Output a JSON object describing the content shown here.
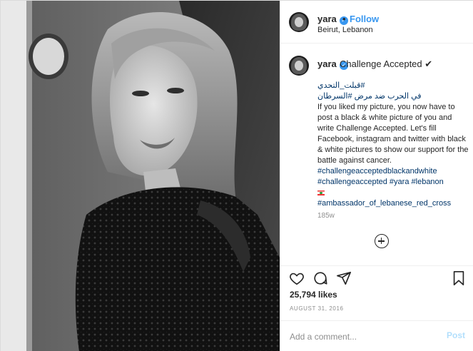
{
  "post": {
    "username": "yara",
    "follow_label": "Follow",
    "separator": "•",
    "location": "Beirut, Lebanon",
    "verified_icon": "verified-badge-icon",
    "caption_title": "Challenge Accepted ✔",
    "caption": {
      "hashtag_ar_1": "#قبلت_التحدي",
      "hashtag_ar_2": "في الحرب ضد مرض #السرطان",
      "body": "If you liked my picture, you now have to post a black & white picture of you and write Challenge Accepted. Let's fill Facebook, instagram and twitter with black & white pictures to show our support for the battle against cancer.",
      "hashtag_1": "#challengeacceptedblackandwhite",
      "hashtag_2": "#challengeaccepted",
      "hashtag_3": "#yara",
      "hashtag_4": "#lebanon",
      "flag": "lebanon-flag-icon",
      "hashtag_5": "#ambassador_of_lebanese_red_cross"
    },
    "age": "185w",
    "likes": "25,794 likes",
    "date": "AUGUST 31, 2016"
  },
  "comment_box": {
    "placeholder": "Add a comment...",
    "post_label": "Post"
  },
  "icons": {
    "like": "heart-icon",
    "comment": "comment-icon",
    "share": "share-icon",
    "save": "bookmark-icon",
    "load_more": "plus-circle-icon"
  },
  "colors": {
    "link": "#003569",
    "follow": "#3897f0",
    "muted": "#8e8e8e",
    "post_disabled": "#b2dffc"
  }
}
